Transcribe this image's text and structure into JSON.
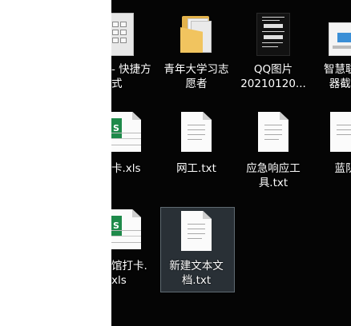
{
  "desktop": {
    "row1": [
      {
        "label": "- 快捷方\n式"
      },
      {
        "label": "青年大学习志\n愿者"
      },
      {
        "label": "QQ图片\n20210120..."
      },
      {
        "label": "智慧联动\n器截图"
      }
    ],
    "row2": [
      {
        "label": "卡.xls"
      },
      {
        "label": "网工.txt"
      },
      {
        "label": "应急响应工\n具.txt"
      },
      {
        "label": "蓝队"
      }
    ],
    "row3": [
      {
        "label": "馆打卡.\nxls"
      },
      {
        "label": "新建文本文\n档.txt"
      }
    ],
    "qq_thumbnail_text": [
      "xxxxxxxxxx",
      "xxxxxxx",
      "情报学习",
      "xxxxx",
      "情报处置",
      "xxxxxxx"
    ]
  },
  "colors": {
    "desktop_bg": "#050505",
    "label": "#ffffff",
    "selection": "#5c6e7d",
    "folder": "#e2b24c",
    "excel": "#1e8a4a"
  }
}
